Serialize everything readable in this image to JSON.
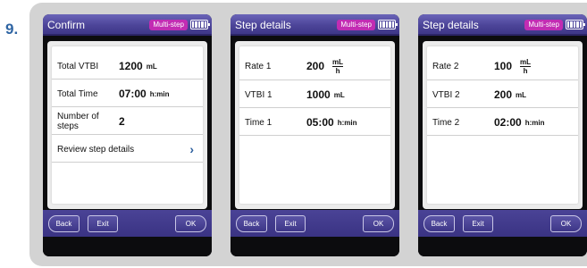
{
  "figure_label": "9.",
  "screens": [
    {
      "title": "Confirm",
      "mode_badge": "Multi-step",
      "rows": {
        "total_vtbi": {
          "label": "Total VTBI",
          "value": "1200",
          "unit": "mL"
        },
        "total_time": {
          "label": "Total Time",
          "value": "07:00",
          "unit": "h:min"
        },
        "num_steps": {
          "label": "Number of steps",
          "value": "2"
        },
        "review": {
          "label": "Review step details"
        }
      },
      "buttons": {
        "back": "Back",
        "exit": "Exit",
        "ok": "OK"
      }
    },
    {
      "title": "Step details",
      "mode_badge": "Multi-step",
      "rows": {
        "rate": {
          "label": "Rate 1",
          "value": "200",
          "unit_num": "mL",
          "unit_den": "h"
        },
        "vtbi": {
          "label": "VTBI 1",
          "value": "1000",
          "unit": "mL"
        },
        "time": {
          "label": "Time 1",
          "value": "05:00",
          "unit": "h:min"
        }
      },
      "buttons": {
        "back": "Back",
        "exit": "Exit",
        "ok": "OK"
      }
    },
    {
      "title": "Step details",
      "mode_badge": "Multi-step",
      "rows": {
        "rate": {
          "label": "Rate 2",
          "value": "100",
          "unit_num": "mL",
          "unit_den": "h"
        },
        "vtbi": {
          "label": "VTBI 2",
          "value": "200",
          "unit": "mL"
        },
        "time": {
          "label": "Time 2",
          "value": "02:00",
          "unit": "h:min"
        }
      },
      "buttons": {
        "back": "Back",
        "exit": "Exit",
        "ok": "OK"
      }
    }
  ],
  "icons": {
    "battery": "battery-icon",
    "chevron": "chevron-right-icon"
  },
  "colors": {
    "title_bar": "#4d4599",
    "mode_badge": "#c22cb3",
    "figure_label": "#2f65a3",
    "chevron": "#2b5f9d"
  }
}
